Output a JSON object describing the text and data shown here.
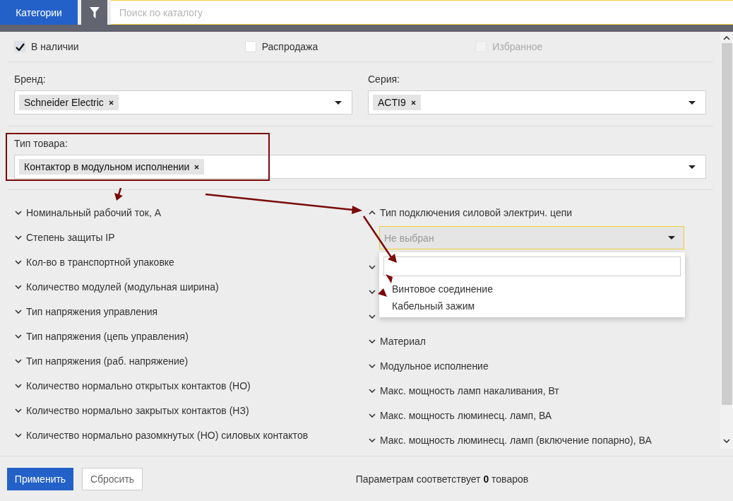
{
  "header": {
    "categories_button": "Категории",
    "search": {
      "placeholder": "Поиск по каталогу"
    }
  },
  "checkboxes": [
    {
      "label": "В наличии",
      "checked": true,
      "disabled": false
    },
    {
      "label": "Распродажа",
      "checked": false,
      "disabled": false
    },
    {
      "label": "Избранное",
      "checked": false,
      "disabled": true
    }
  ],
  "selects": [
    {
      "label": "Бренд:",
      "tags": [
        "Schneider Electric"
      ]
    },
    {
      "label": "Серия:",
      "tags": [
        "ACTI9"
      ]
    }
  ],
  "product_type": {
    "label": "Тип товара:",
    "tags": [
      "Контактор в модульном исполнении"
    ]
  },
  "filters_left": [
    {
      "label": "Номинальный рабочий ток, А",
      "expanded": false
    },
    {
      "label": "Степень защиты IP",
      "expanded": false
    },
    {
      "label": "Кол-во в транспортной упаковке",
      "expanded": false
    },
    {
      "label": "Количество модулей (модульная ширина)",
      "expanded": false
    },
    {
      "label": "Тип напряжения управления",
      "expanded": false
    },
    {
      "label": "Тип напряжения (цепь управления)",
      "expanded": false
    },
    {
      "label": "Тип напряжения (раб. напряжение)",
      "expanded": false
    },
    {
      "label": "Количество нормально открытых контактов (НО)",
      "expanded": false
    },
    {
      "label": "Количество нормально закрытых контактов (НЗ)",
      "expanded": false
    },
    {
      "label": "Количество нормально разомкнутых (НО) силовых контактов",
      "expanded": false
    }
  ],
  "filters_right": [
    {
      "label": "Тип подключения силовой электрич. цепи",
      "expanded": true,
      "select": {
        "placeholder": "Не выбран",
        "open": true,
        "options": [
          {
            "label": "Винтовое соединение",
            "selected": false
          },
          {
            "label": "Кабельный зажим",
            "selected": false
          }
        ]
      }
    },
    {
      "expanded": false
    },
    {
      "expanded": false
    },
    {
      "expanded": false
    },
    {
      "label": "Материал",
      "expanded": false
    },
    {
      "label": "Модульное исполнение",
      "expanded": false
    },
    {
      "label": "Макс. мощность ламп накаливания, Вт",
      "expanded": false
    },
    {
      "label": "Макс. мощность люминесц. ламп, ВА",
      "expanded": false
    },
    {
      "label": "Макс. мощность люминесц. ламп (включение попарно), ВА",
      "expanded": false
    }
  ],
  "footer": {
    "apply_button": "Применить",
    "reset_button": "Сбросить",
    "result_text": "Параметрам соответствует **0** товаров"
  }
}
